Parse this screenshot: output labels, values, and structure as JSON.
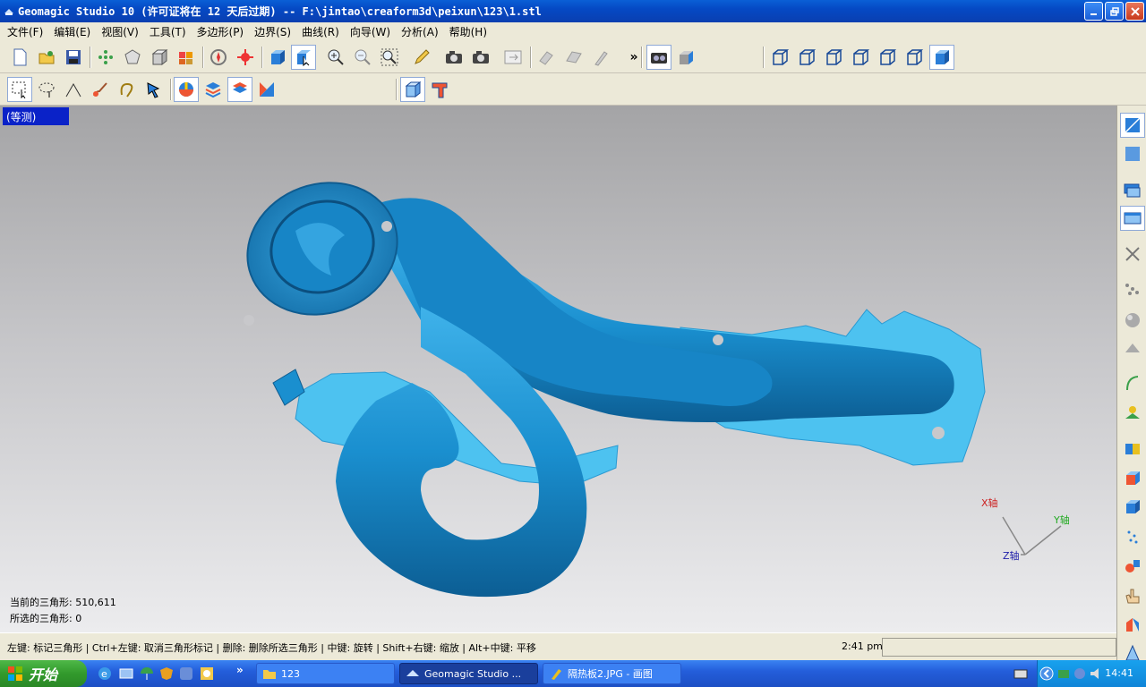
{
  "window": {
    "title": "Geomagic Studio 10 (许可证将在 12 天后过期) -- F:\\jintao\\creaform3d\\peixun\\123\\1.stl"
  },
  "menu": [
    "文件(F)",
    "编辑(E)",
    "视图(V)",
    "工具(T)",
    "多边形(P)",
    "边界(S)",
    "曲线(R)",
    "向导(W)",
    "分析(A)",
    "帮助(H)"
  ],
  "toolbar1": {
    "overflow": "»"
  },
  "viewport": {
    "view_label": "(等测)",
    "axes": {
      "x": "X轴",
      "y": "Y轴",
      "z": "Z轴"
    },
    "stats": {
      "current_triangles": "当前的三角形: 510,611",
      "selected_triangles": "所选的三角形: 0"
    }
  },
  "status": {
    "hint": "左键: 标记三角形 | Ctrl+左键: 取消三角形标记 | 删除: 删除所选三角形 | 中键: 旋转 | Shift+右键: 缩放 | Alt+中键: 平移",
    "time": "2:41 pm"
  },
  "taskbar": {
    "start": "开始",
    "overflow": "»",
    "tasks": [
      {
        "label": "123"
      },
      {
        "label": "Geomagic Studio ..."
      },
      {
        "label": "隔热板2.JPG - 画图"
      }
    ],
    "clock": "14:41"
  },
  "colors": {
    "model": "#1a8fcf",
    "model_flange": "#4dc2f0",
    "view_label_bg": "#0a22c8"
  }
}
